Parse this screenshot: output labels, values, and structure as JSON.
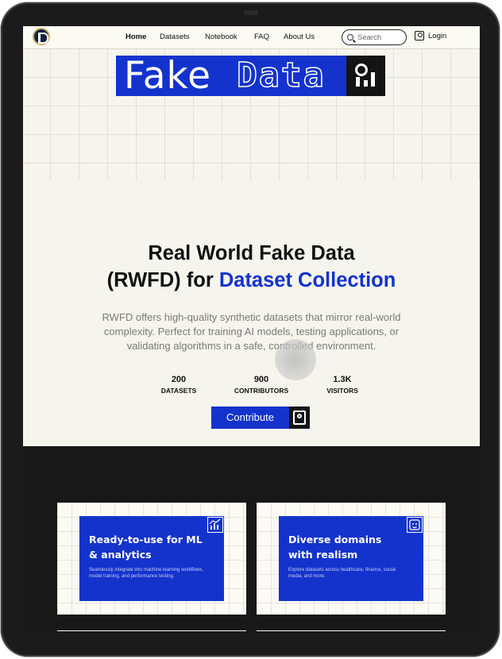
{
  "nav": {
    "links": [
      "Home",
      "Datasets",
      "Notebook",
      "FAQ",
      "About Us"
    ],
    "search_placeholder": "Search",
    "login_label": "Login"
  },
  "brand": {
    "word1": "Fake",
    "word2": "Data"
  },
  "hero": {
    "title_line1": "Real World Fake Data",
    "title_line2_plain": "(RWFD) for ",
    "title_line2_accent": "Dataset Collection",
    "subtitle": "RWFD offers high-quality synthetic datasets that mirror real-world complexity. Perfect for training AI models, testing applications, or validating algorithms in a safe, controlled environment.",
    "stats": [
      {
        "value": "200",
        "label": "DATASETS"
      },
      {
        "value": "900",
        "label": "CONTRIBUTORS"
      },
      {
        "value": "1.3K",
        "label": "VISITORS"
      }
    ],
    "cta_label": "Contribute"
  },
  "features": [
    {
      "title": "Ready-to-use for ML & analytics",
      "desc": "Seamlessly integrate into machine learning workflows, model training, and performance testing.",
      "icon": "chart-icon"
    },
    {
      "title": "Diverse domains with realism",
      "desc": "Explore datasets across healthcare, finance, social media, and more.",
      "icon": "face-icon"
    }
  ],
  "colors": {
    "accent": "#1433cc",
    "dark": "#181818",
    "hero_bg": "#f6f5ed"
  }
}
